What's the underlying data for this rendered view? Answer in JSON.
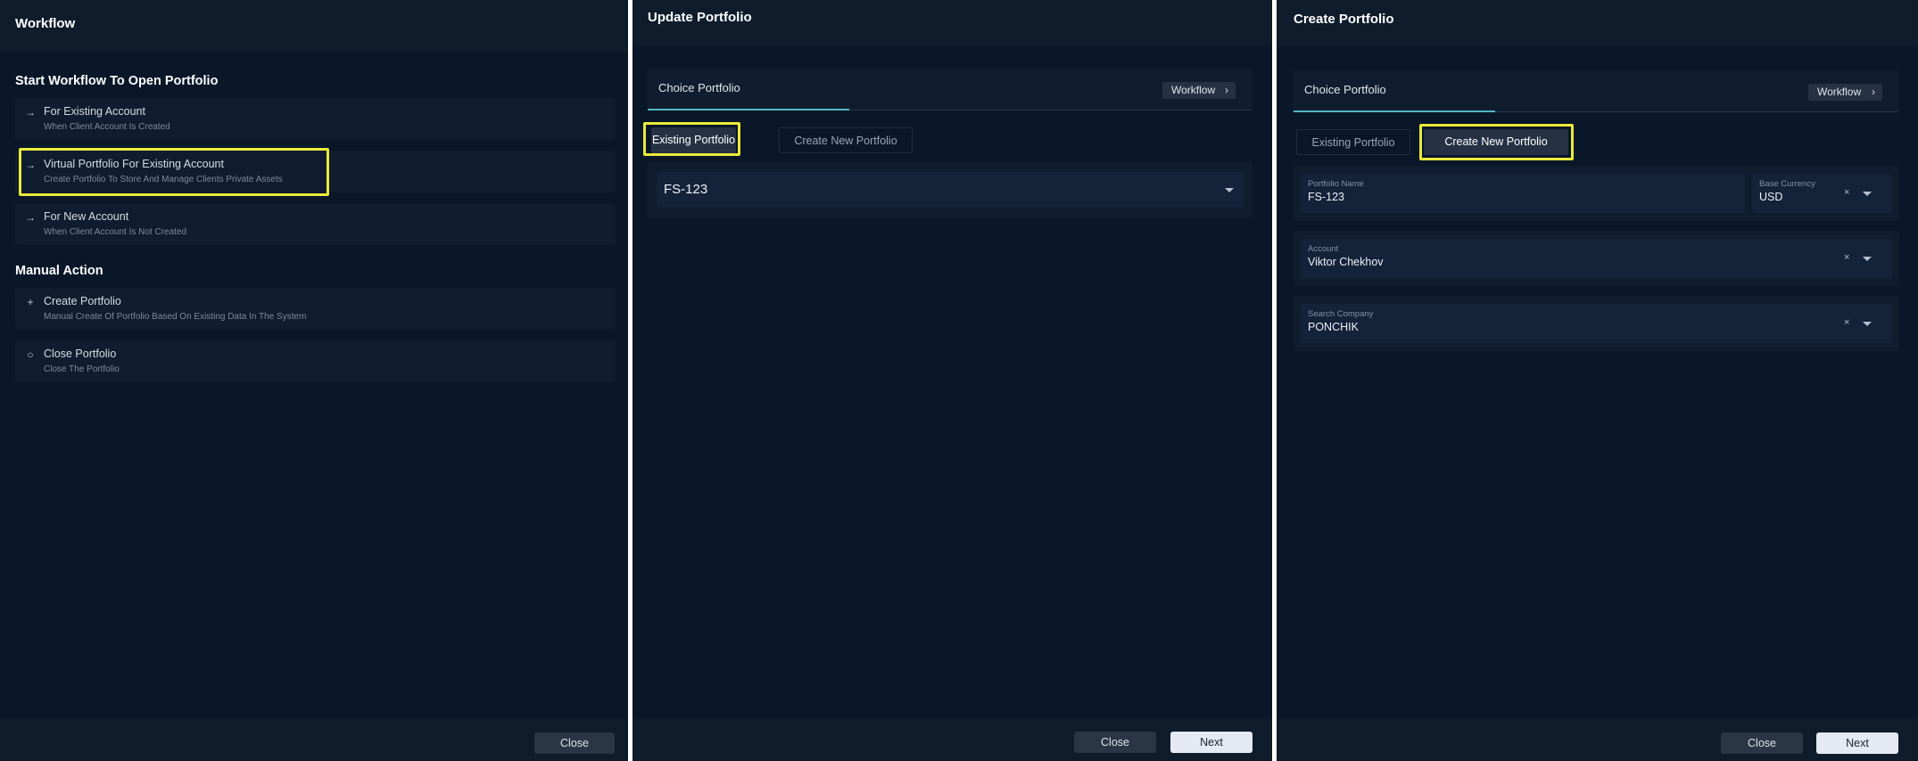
{
  "workflow": {
    "title": "Workflow",
    "section_open": "Start Workflow To Open Portfolio",
    "open_items": [
      {
        "icon": "arrow-right-icon",
        "title": "For Existing Account",
        "subtitle": "When Client Account Is Created"
      },
      {
        "icon": "arrow-right-icon",
        "title": "Virtual Portfolio For Existing Account",
        "subtitle": "Create Portfolio To Store And Manage Clients Private Assets"
      },
      {
        "icon": "arrow-right-icon",
        "title": "For New Account",
        "subtitle": "When Client Account Is Not Created"
      }
    ],
    "section_manual": "Manual Action",
    "manual_items": [
      {
        "icon": "plus-icon",
        "title": "Create Portfolio",
        "subtitle": "Manual Create Of Portfolio Based On Existing Data In The System"
      },
      {
        "icon": "circle-icon",
        "title": "Close Portfolio",
        "subtitle": "Close The Portfolio"
      }
    ],
    "close_label": "Close"
  },
  "update": {
    "title": "Update Portfolio",
    "choice_tab": "Choice Portfolio",
    "workflow_button": "Workflow",
    "segments": [
      "Existing Portfolio",
      "Create New Portfolio"
    ],
    "selected_portfolio": "FS-123",
    "close_label": "Close",
    "next_label": "Next"
  },
  "create": {
    "title": "Create Portfolio",
    "choice_tab": "Choice Portfolio",
    "workflow_button": "Workflow",
    "segments": [
      "Existing Portfolio",
      "Create New Portfolio"
    ],
    "portfolio_name_label": "Portfolio Name",
    "portfolio_name_value": "FS-123",
    "base_currency_label": "Base Currency",
    "base_currency_value": "USD",
    "account_label": "Account",
    "account_value": "Viktor Chekhov",
    "company_label": "Search Company",
    "company_value": "PONCHIK",
    "clear_glyph": "×",
    "close_label": "Close",
    "next_label": "Next"
  },
  "icons": {
    "arrow_right": "→",
    "plus": "+",
    "circle": "○",
    "chevron": "›"
  },
  "colors": {
    "background": "#091728",
    "header": "#0e1c2c",
    "highlight": "#eaea3b",
    "tab_underline": "#53b7c6"
  }
}
